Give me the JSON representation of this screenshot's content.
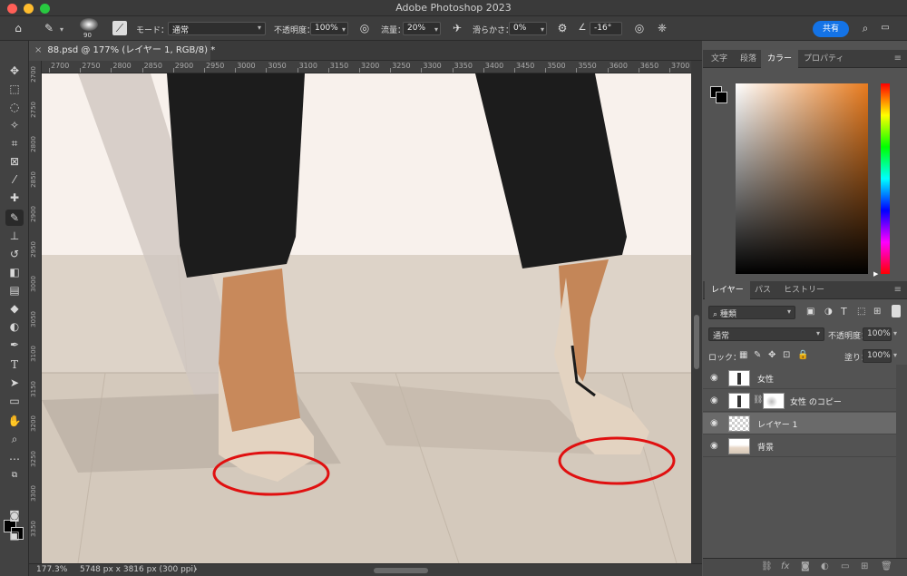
{
  "window": {
    "title": "Adobe Photoshop 2023"
  },
  "options_bar": {
    "brush_size": "90",
    "mode_label": "モード：",
    "mode_value": "通常",
    "opacity_label": "不透明度：",
    "opacity_value": "100%",
    "flow_label": "流量：",
    "flow_value": "20%",
    "smoothing_label": "滑らかさ：",
    "smoothing_value": "0%",
    "angle_value": "-16°",
    "share_label": "共有"
  },
  "document": {
    "tab_label": "88.psd @ 177% (レイヤー 1, RGB/8) *",
    "ruler_h_ticks": [
      "2700",
      "2750",
      "2800",
      "2850",
      "2900",
      "2950",
      "3000",
      "3050",
      "3100",
      "3150",
      "3200",
      "3250",
      "3300",
      "3350",
      "3400",
      "3450",
      "3500",
      "3550",
      "3600",
      "3650",
      "3700"
    ],
    "ruler_v_ticks": [
      "2700",
      "2750",
      "2800",
      "2850",
      "2900",
      "2950",
      "3000",
      "3050",
      "3100",
      "3150",
      "3200",
      "3250",
      "3300",
      "3350"
    ]
  },
  "status": {
    "zoom": "177.3%",
    "doc_size": "5748 px x 3816 px (300 ppi)"
  },
  "panels": {
    "top_tabs": [
      "文字",
      "段落",
      "カラー",
      "プロパティ"
    ],
    "top_active": "カラー",
    "layer_tabs": [
      "レイヤー",
      "パス",
      "ヒストリー"
    ],
    "layer_active": "レイヤー",
    "filter_kind": "種類",
    "blend_mode": "通常",
    "opacity_label": "不透明度：",
    "opacity_value": "100%",
    "lock_label": "ロック：",
    "fill_label": "塗り：",
    "fill_value": "100%",
    "layers": [
      {
        "name": "女性",
        "selected": false
      },
      {
        "name": "女性 のコピー",
        "selected": false
      },
      {
        "name": "レイヤー 1",
        "selected": true
      },
      {
        "name": "背景",
        "selected": false
      }
    ]
  },
  "colors": {
    "accent": "#1473e6",
    "annotation_circle": "#e01010",
    "picker_hue": "#e87b1e"
  }
}
